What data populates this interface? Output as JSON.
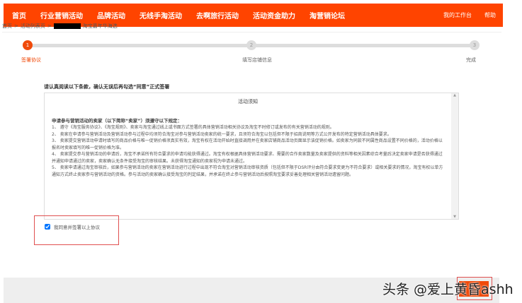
{
  "nav": {
    "items": [
      "首页",
      "行业营销活动",
      "品牌活动",
      "无线手淘活动",
      "去啊旅行活动",
      "活动资金助力",
      "淘营销论坛"
    ],
    "right": [
      "我的工作台",
      "帮助"
    ]
  },
  "breadcrumb": {
    "home": "首页",
    "sep": ">",
    "list": "活动列表页",
    "current": "淘宝嘉年华海选"
  },
  "steps": [
    {
      "num": "1",
      "label": "签署协议"
    },
    {
      "num": "2",
      "label": "填写店铺信息"
    },
    {
      "num": "3",
      "label": "完成"
    }
  ],
  "intro": "请认真阅读以下条款，确认无误后再勾选“同意”正式签署",
  "agreement": {
    "title": "活动须知",
    "lead": "申请参与营销活动的卖家（以下简称“卖家”）须遵守以下规定：",
    "clauses": [
      "1、 遵守《淘宝服务协议》、《淘宝规则》、卖家与淘宝通过线上或书面方式签署的具体营销活动相关协议及淘宝不时修订或发布的有关营销活动的规则。",
      "2、 卖家在申请参与营销活动及营销活动参与过程中均须符合淘宝对参与营销活动卖家的统一要求，且须符合淘宝以包括但不限于招商说明等方式公开发布的特定营销活动具体要求。",
      "3、 卖家提交营销活动申请时填写的商品价格与唯一促销价格须真实有效，淘宝有权在活动开始时直接调用并在卖家店铺商品活动页面显示该促销价格。如卖家为同款不同属性商品设置不同价格的，活动价格以报名时卖家填写的唯一促销价格为准。",
      "4、 卖家提交参与营销活动的申请后，淘宝不承诺所有符合要求的申请均能获得通过。淘宝有权根据具体营销活动要求、需要的合作卖家数量及卖家提供的资料等相关因素综合考量后决定卖家申请是否获得通过并通知申请通过的卖家，卖家确认无条件接受淘宝的审核结果。未获得淘宝通知的卖家视为申请未通过。",
      "5、 卖家申请通过淘宝审核后，如果参与营销活动的卖家在营销活动进行过程中出现不符合淘宝对营销活动审核资质（包括但不限于DSR评分由符合要求变更为不符合要求）或相关要求的情况，淘宝有权以单方通知方式终止卖家参与营销活动的资格。参与活动的卖家确认接受淘宝的判定结果，并承诺在终止参与营销活动后按照淘宝要求妥善处理相关营销活动遗留问题。"
    ]
  },
  "agree_label": "我同意并签署以上协议",
  "watermark": "头条 @爱上黄昏ashh",
  "colors": {
    "brand": "#ff4400",
    "highlight": "#e05050"
  }
}
